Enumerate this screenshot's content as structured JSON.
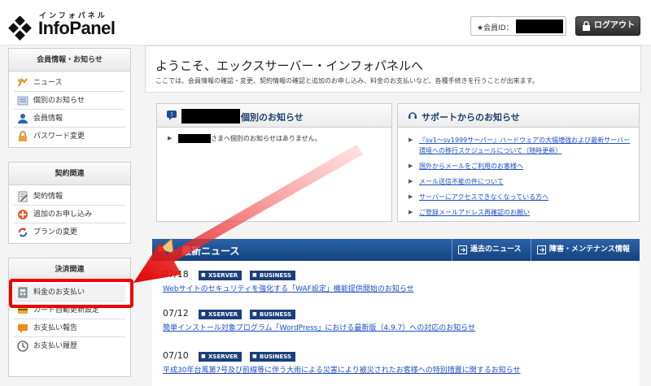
{
  "header": {
    "logo_kana": "インフォパネル",
    "logo_text": "InfoPanel",
    "member_label": "★会員ID：",
    "logout_label": "ログアウト"
  },
  "sidebar": {
    "sections": [
      {
        "title": "会員情報・お知らせ",
        "items": [
          {
            "label": "ニュース",
            "icon": "news-icon"
          },
          {
            "label": "個別のお知らせ",
            "icon": "notice-icon"
          },
          {
            "label": "会員情報",
            "icon": "user-icon"
          },
          {
            "label": "パスワード変更",
            "icon": "lock-icon"
          }
        ]
      },
      {
        "title": "契約関連",
        "items": [
          {
            "label": "契約情報",
            "icon": "contract-icon"
          },
          {
            "label": "追加のお申し込み",
            "icon": "add-icon"
          },
          {
            "label": "プランの変更",
            "icon": "refresh-icon"
          }
        ]
      },
      {
        "title": "決済関連",
        "items": [
          {
            "label": "料金のお支払い",
            "icon": "calculator-icon"
          },
          {
            "label": "カード自動更新設定",
            "icon": "card-icon"
          },
          {
            "label": "お支払い報告",
            "icon": "report-icon"
          },
          {
            "label": "お支払い履歴",
            "icon": "clock-icon"
          }
        ]
      }
    ]
  },
  "welcome": {
    "title": "ようこそ、エックスサーバー・インフォパネルへ",
    "subtitle": "ここでは、会員情報の確認・変更、契約情報の確認と追加のお申し込み、料金のお支払いなど、各種手続きを行うことが出来ます。"
  },
  "personal_notice": {
    "title_suffix": "個別のお知らせ",
    "line_suffix": "さまへ個別のお知らせはありません。"
  },
  "support_notice": {
    "title": "サポートからのお知らせ",
    "items": [
      "『sv1～sv1999サーバー』ハードウェアの大幅増強および最新サーバー環境への移行スケジュールについて（随時更新）",
      "国外からメールをご利用のお客様へ",
      "メール送信不能の件について",
      "サーバーにアクセスできなくなっている方へ",
      "ご登録メールアドレス再確認のお願い"
    ]
  },
  "news": {
    "title": "最新ニュース",
    "tab_past": "過去のニュース",
    "tab_maintenance": "障害・メンテナンス情報",
    "items": [
      {
        "date": "07/18",
        "badge1": "XSERVER",
        "badge2": "BUSINESS",
        "link": "Webサイトのセキュリティを強化する「WAF設定」機能提供開始のお知らせ"
      },
      {
        "date": "07/12",
        "badge1": "XSERVER",
        "badge2": "BUSINESS",
        "link": "簡単インストール対象プログラム「WordPress」における最新版（4.9.7）への対応のお知らせ"
      },
      {
        "date": "07/10",
        "badge1": "XSERVER",
        "badge2": "BUSINESS",
        "link": "平成30年台風第7号及び前線等に伴う大雨による災害により被災されたお客様への特別措置に関するお知らせ"
      }
    ]
  },
  "colors": {
    "accent_blue": "#1b3e6c",
    "news_bar": "#2c63a8",
    "link": "#1d4ec7",
    "annotation_red": "#e00000"
  }
}
